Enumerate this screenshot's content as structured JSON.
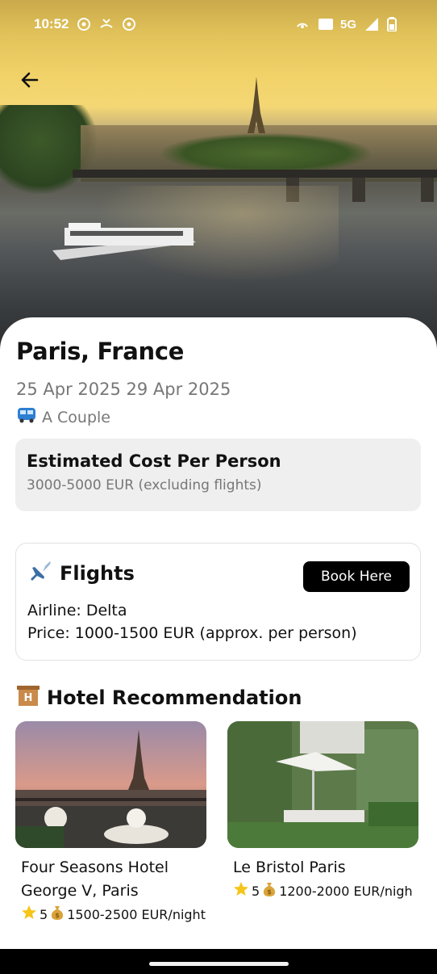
{
  "status_bar": {
    "time": "10:52",
    "network": "5G",
    "icons": [
      "whatsapp-icon",
      "missed-call-icon",
      "whatsapp-icon",
      "hotspot-icon",
      "nfc-icon",
      "signal-icon",
      "battery-icon"
    ]
  },
  "hero": {
    "image": "Paris Seine river with Eiffel Tower at sunset"
  },
  "trip": {
    "destination": "Paris, France",
    "dates": "25 Apr 2025  29 Apr 2025",
    "travelers": "A Couple",
    "travelers_icon": "bus-icon"
  },
  "cost": {
    "title": "Estimated Cost Per Person",
    "value": "3000-5000 EUR (excluding flights)"
  },
  "flights": {
    "title": "Flights",
    "icon": "airplane-icon",
    "book_label": "Book Here",
    "airline": "Airline: Delta",
    "price": "Price: 1000-1500 EUR (approx. per person)"
  },
  "hotels": {
    "title": "Hotel Recommendation",
    "icon": "hotel-icon",
    "items": [
      {
        "name": "Four Seasons Hotel George V, Paris",
        "rating": "5",
        "price": "1500-2500 EUR/night"
      },
      {
        "name": "Le Bristol Paris",
        "rating": "5",
        "price": "1200-2000 EUR/nigh"
      }
    ]
  },
  "colors": {
    "accent": "#000000",
    "muted_text": "#777777",
    "card_bg": "#efefef"
  }
}
